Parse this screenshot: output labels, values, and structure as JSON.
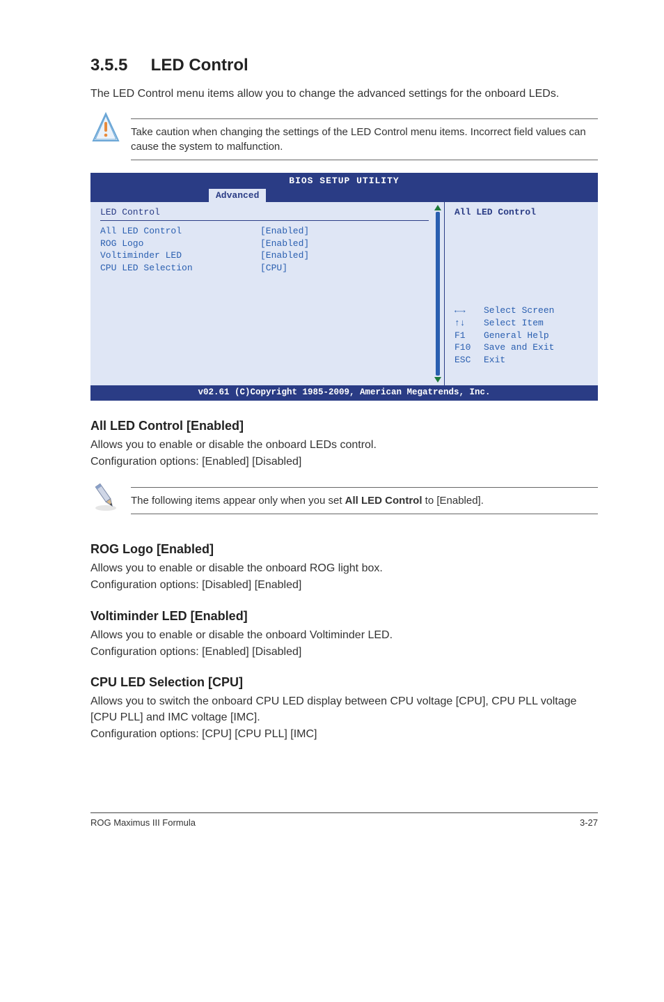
{
  "section": {
    "number": "3.5.5",
    "title": "LED Control"
  },
  "intro": "The LED Control menu items allow you to change the advanced settings for the onboard LEDs.",
  "caution": "Take caution when changing the settings of the LED Control menu items. Incorrect field values can cause the system to malfunction.",
  "bios": {
    "title": "BIOS SETUP UTILITY",
    "tab": "Advanced",
    "section_label": "LED Control",
    "rows": [
      {
        "k": "All LED Control",
        "v": "[Enabled]"
      },
      {
        "k": "ROG Logo",
        "v": "[Enabled]"
      },
      {
        "k": "Voltiminder LED",
        "v": "[Enabled]"
      },
      {
        "k": "CPU LED Selection",
        "v": "[CPU]"
      }
    ],
    "help_header": "All LED Control",
    "keys": [
      {
        "k": "←→",
        "d": "Select Screen"
      },
      {
        "k": "↑↓",
        "d": "Select Item"
      },
      {
        "k": "F1",
        "d": "General Help"
      },
      {
        "k": "F10",
        "d": "Save and Exit"
      },
      {
        "k": "ESC",
        "d": "Exit"
      }
    ],
    "footer": "v02.61 (C)Copyright 1985-2009, American Megatrends, Inc."
  },
  "subs": {
    "all_led": {
      "h": "All LED Control [Enabled]",
      "p1": "Allows you to enable or disable the onboard LEDs control.",
      "p2": "Configuration options: [Enabled] [Disabled]"
    },
    "note_following_prefix": "The following items appear only when you set ",
    "note_following_bold": "All LED Control",
    "note_following_suffix": " to [Enabled].",
    "rog": {
      "h": "ROG Logo [Enabled]",
      "p1": "Allows you to enable or disable the onboard ROG light box.",
      "p2": "Configuration options: [Disabled] [Enabled]"
    },
    "volt": {
      "h": "Voltiminder LED [Enabled]",
      "p1": "Allows you to enable or disable the onboard Voltiminder LED.",
      "p2": "Configuration options: [Enabled] [Disabled]"
    },
    "cpu": {
      "h": "CPU LED Selection [CPU]",
      "p1": "Allows you to switch the onboard CPU LED display between CPU voltage [CPU], CPU PLL voltage [CPU PLL] and IMC voltage [IMC].",
      "p2": "Configuration options: [CPU] [CPU PLL] [IMC]"
    }
  },
  "footer": {
    "left": "ROG Maximus III Formula",
    "right": "3-27"
  }
}
